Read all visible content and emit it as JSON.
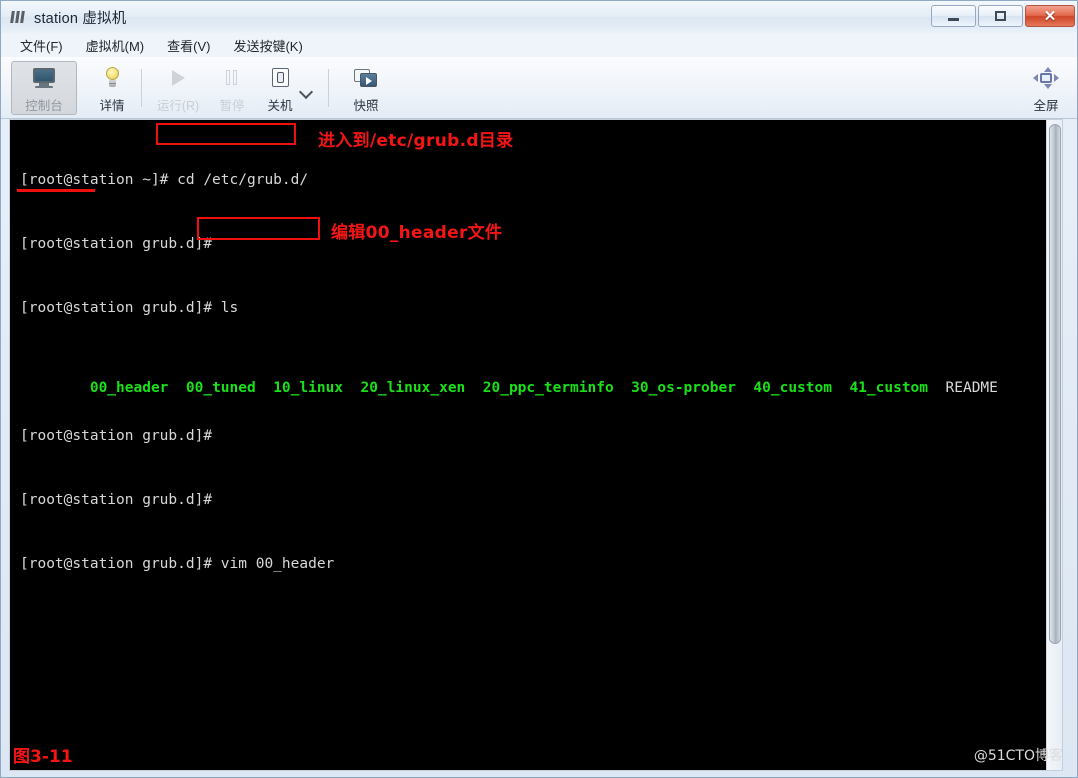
{
  "window": {
    "title": "station 虚拟机",
    "icon": "vmware-logo-icon",
    "buttons": {
      "minimize": "–",
      "maximize": "□",
      "close": "✕"
    }
  },
  "menubar": {
    "items": [
      {
        "label": "文件(F)"
      },
      {
        "label": "虚拟机(M)"
      },
      {
        "label": "查看(V)"
      },
      {
        "label": "发送按键(K)"
      }
    ]
  },
  "toolbar": {
    "items": [
      {
        "label": "控制台",
        "icon": "monitor-icon",
        "state": "active"
      },
      {
        "label": "详情",
        "icon": "lightbulb-icon",
        "state": "enabled"
      },
      {
        "label": "运行(R)",
        "icon": "play-icon",
        "state": "disabled"
      },
      {
        "label": "暂停",
        "icon": "pause-icon",
        "state": "disabled"
      },
      {
        "label": "关机",
        "icon": "power-icon",
        "state": "enabled"
      },
      {
        "label": "快照",
        "icon": "snapshot-icon",
        "state": "enabled"
      }
    ],
    "dropdown_icon": "chevron-down-icon",
    "fullscreen": {
      "label": "全屏",
      "icon": "fullscreen-arrows-icon"
    }
  },
  "terminal": {
    "background": "#000000",
    "foreground": "#d8d8d8",
    "dir_color": "#19e019",
    "lines": [
      {
        "prompt": "[root@station ~]# ",
        "command": "cd /etc/grub.d/"
      },
      {
        "prompt": "[root@station grub.d]# ",
        "command": ""
      },
      {
        "prompt": "[root@station grub.d]# ",
        "command": "ls"
      }
    ],
    "ls_output": [
      {
        "name": "00_header",
        "type": "dir"
      },
      {
        "name": "00_tuned",
        "type": "dir"
      },
      {
        "name": "10_linux",
        "type": "dir"
      },
      {
        "name": "20_linux_xen",
        "type": "dir"
      },
      {
        "name": "20_ppc_terminfo",
        "type": "dir"
      },
      {
        "name": "30_os-prober",
        "type": "dir"
      },
      {
        "name": "40_custom",
        "type": "dir"
      },
      {
        "name": "41_custom",
        "type": "dir"
      },
      {
        "name": "README",
        "type": "file"
      }
    ],
    "lines_after": [
      {
        "prompt": "[root@station grub.d]# ",
        "command": ""
      },
      {
        "prompt": "[root@station grub.d]# ",
        "command": ""
      },
      {
        "prompt": "[root@station grub.d]# ",
        "command": "vim 00_header"
      }
    ]
  },
  "annotations": {
    "color": "#f41515",
    "note_cd": "进入到/etc/grub.d目录",
    "note_vim": "编辑00_header文件",
    "figure_caption": "图3-11",
    "watermark": "@51CTO博客"
  }
}
